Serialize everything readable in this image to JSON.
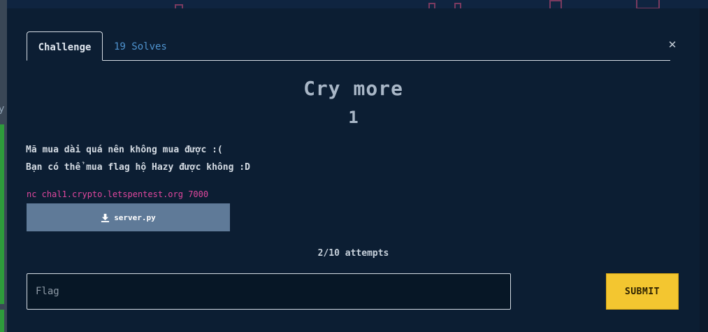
{
  "modal": {
    "tabs": [
      {
        "label": "Challenge",
        "active": true
      },
      {
        "label": "19 Solves",
        "active": false
      }
    ],
    "close_icon": "close-icon",
    "challenge": {
      "name": "Cry more",
      "points": "1",
      "description": [
        "Mã mua dài quá nên không mua được :(",
        "Bạn có thể mua flag hộ Hazy được không :D"
      ],
      "connection": "nc chal1.crypto.letspentest.org 7000",
      "file": {
        "icon": "download-icon",
        "name": "server.py"
      },
      "attempts": "2/10 attempts"
    },
    "flag_input": {
      "placeholder": "Flag",
      "value": ""
    },
    "submit_label": "SUBMIT"
  },
  "colors": {
    "modal_bg": "#0c1e33",
    "link_blue": "#4f93cf",
    "connection_pink": "#e0479e",
    "file_button": "#5f7a98",
    "submit_yellow": "#f3c630"
  }
}
